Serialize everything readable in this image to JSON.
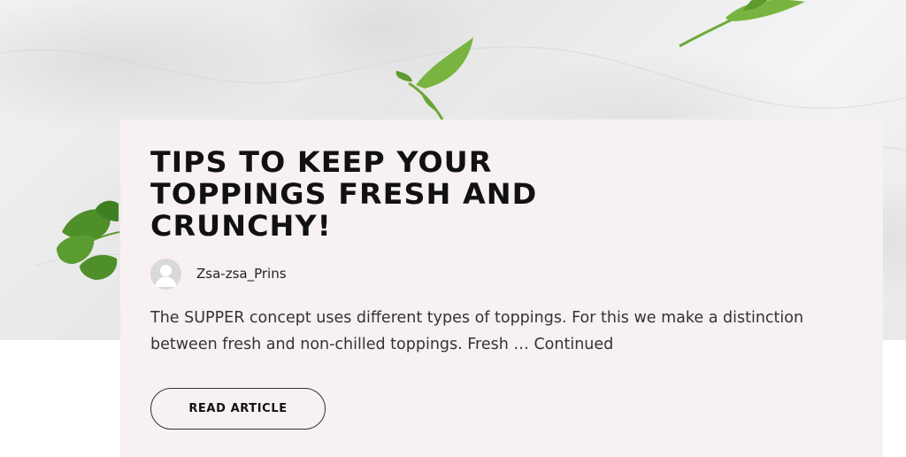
{
  "hero": {
    "image": "marble-herbs-background"
  },
  "article": {
    "title": "TIPS TO KEEP YOUR TOPPINGS FRESH AND CRUNCHY!",
    "author": {
      "name": "Zsa-zsa_Prins",
      "avatar_icon": "default-user-avatar-icon"
    },
    "excerpt": "The SUPPER concept uses different types of toppings. For this we make a distinction between fresh and non-chilled toppings. Fresh … Continued",
    "read_button_label": "READ ARTICLE"
  },
  "colors": {
    "card_background": "#f8f1f1",
    "title": "#111111",
    "body_text": "#333333",
    "leaf_green": "#6fae38"
  }
}
